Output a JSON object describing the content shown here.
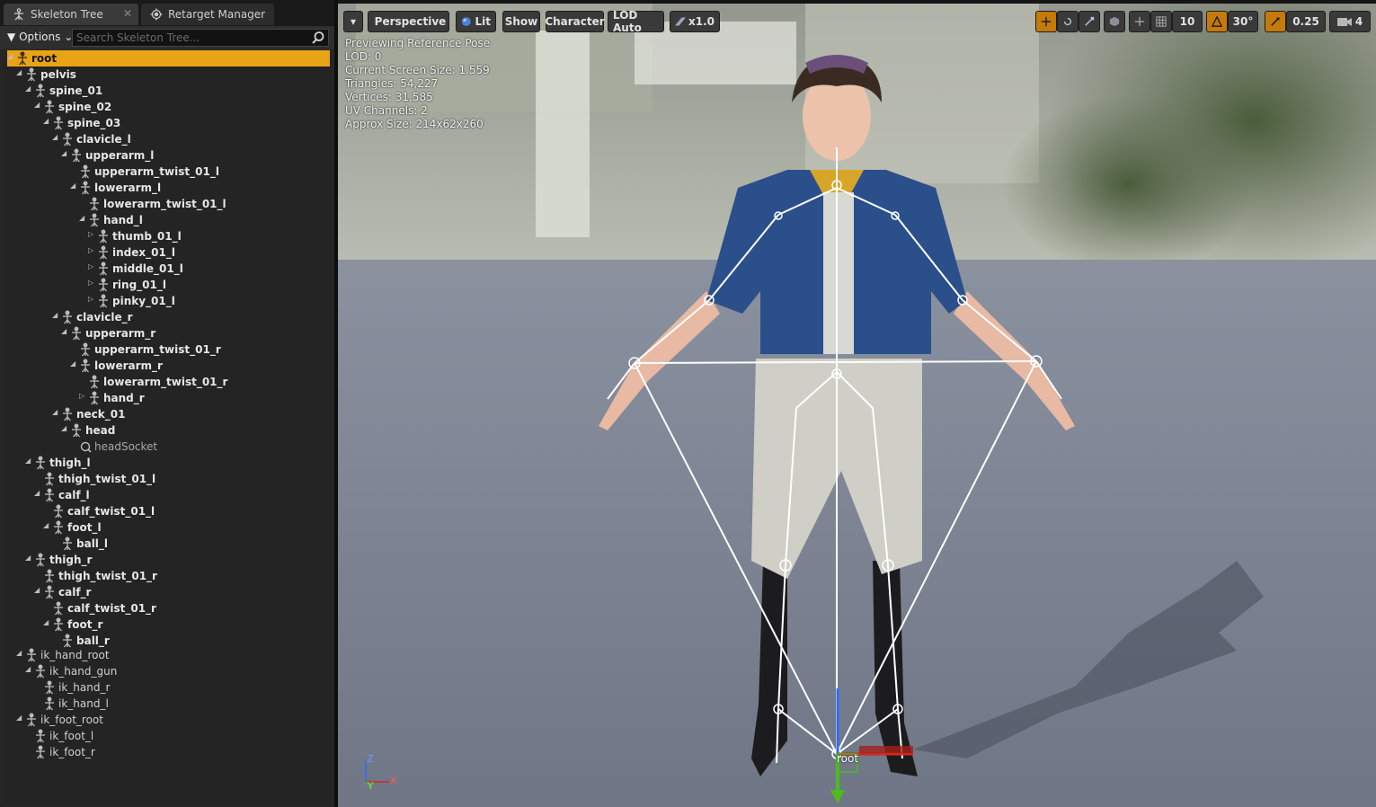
{
  "tabs": [
    {
      "label": "Skeleton Tree",
      "icon": "skeleton-icon"
    },
    {
      "label": "Retarget Manager",
      "icon": "retarget-icon"
    }
  ],
  "tree_toolbar": {
    "options_label": "Options",
    "search_placeholder": "Search Skeleton Tree..."
  },
  "bones": [
    {
      "name": "root",
      "depth": 0
    },
    {
      "name": "pelvis",
      "depth": 1
    },
    {
      "name": "spine_01",
      "depth": 2
    },
    {
      "name": "spine_02",
      "depth": 3
    },
    {
      "name": "spine_03",
      "depth": 4
    },
    {
      "name": "clavicle_l",
      "depth": 5
    },
    {
      "name": "upperarm_l",
      "depth": 6
    },
    {
      "name": "upperarm_twist_01_l",
      "depth": 7
    },
    {
      "name": "lowerarm_l",
      "depth": 7
    },
    {
      "name": "lowerarm_twist_01_l",
      "depth": 8
    },
    {
      "name": "hand_l",
      "depth": 8
    },
    {
      "name": "thumb_01_l",
      "depth": 9
    },
    {
      "name": "index_01_l",
      "depth": 9
    },
    {
      "name": "middle_01_l",
      "depth": 9
    },
    {
      "name": "ring_01_l",
      "depth": 9
    },
    {
      "name": "pinky_01_l",
      "depth": 9
    },
    {
      "name": "clavicle_r",
      "depth": 5
    },
    {
      "name": "upperarm_r",
      "depth": 6
    },
    {
      "name": "upperarm_twist_01_r",
      "depth": 7
    },
    {
      "name": "lowerarm_r",
      "depth": 7
    },
    {
      "name": "lowerarm_twist_01_r",
      "depth": 8
    },
    {
      "name": "hand_r",
      "depth": 8
    },
    {
      "name": "neck_01",
      "depth": 5
    },
    {
      "name": "head",
      "depth": 6
    },
    {
      "name": "headSocket",
      "depth": 7
    },
    {
      "name": "thigh_l",
      "depth": 2
    },
    {
      "name": "thigh_twist_01_l",
      "depth": 3
    },
    {
      "name": "calf_l",
      "depth": 3
    },
    {
      "name": "calf_twist_01_l",
      "depth": 4
    },
    {
      "name": "foot_l",
      "depth": 4
    },
    {
      "name": "ball_l",
      "depth": 5
    },
    {
      "name": "thigh_r",
      "depth": 2
    },
    {
      "name": "thigh_twist_01_r",
      "depth": 3
    },
    {
      "name": "calf_r",
      "depth": 3
    },
    {
      "name": "calf_twist_01_r",
      "depth": 4
    },
    {
      "name": "foot_r",
      "depth": 4
    },
    {
      "name": "ball_r",
      "depth": 5
    },
    {
      "name": "ik_hand_root",
      "depth": 1
    },
    {
      "name": "ik_hand_gun",
      "depth": 2
    },
    {
      "name": "ik_hand_r",
      "depth": 3
    },
    {
      "name": "ik_hand_l",
      "depth": 3
    },
    {
      "name": "ik_foot_root",
      "depth": 1
    },
    {
      "name": "ik_foot_l",
      "depth": 2
    },
    {
      "name": "ik_foot_r",
      "depth": 2
    }
  ],
  "viewport_toolbar": {
    "perspective_label": "Perspective",
    "lit_label": "Lit",
    "show_label": "Show",
    "character_label": "Character",
    "lod_label": "LOD Auto",
    "speed_label": "x1.0",
    "grid_snap_value": "10",
    "rotation_snap_value": "30°",
    "scale_snap_value": "0.25",
    "camera_speed_value": "4"
  },
  "stats": {
    "line1": "Previewing Reference Pose",
    "line2": "LOD: 0",
    "line3": "Current Screen Size: 1.559",
    "line4": "Triangles: 54,227",
    "line5": "Vertices: 31,585",
    "line6": "UV Channels: 2",
    "line7": "Approx Size: 214x62x260"
  },
  "gizmo": {
    "z_label": "Z",
    "x_label": "X",
    "y_label": "Y",
    "root_label": "root"
  },
  "colors": {
    "selection": "#e8a317",
    "panel": "#242424",
    "floor": "#7d8594"
  }
}
